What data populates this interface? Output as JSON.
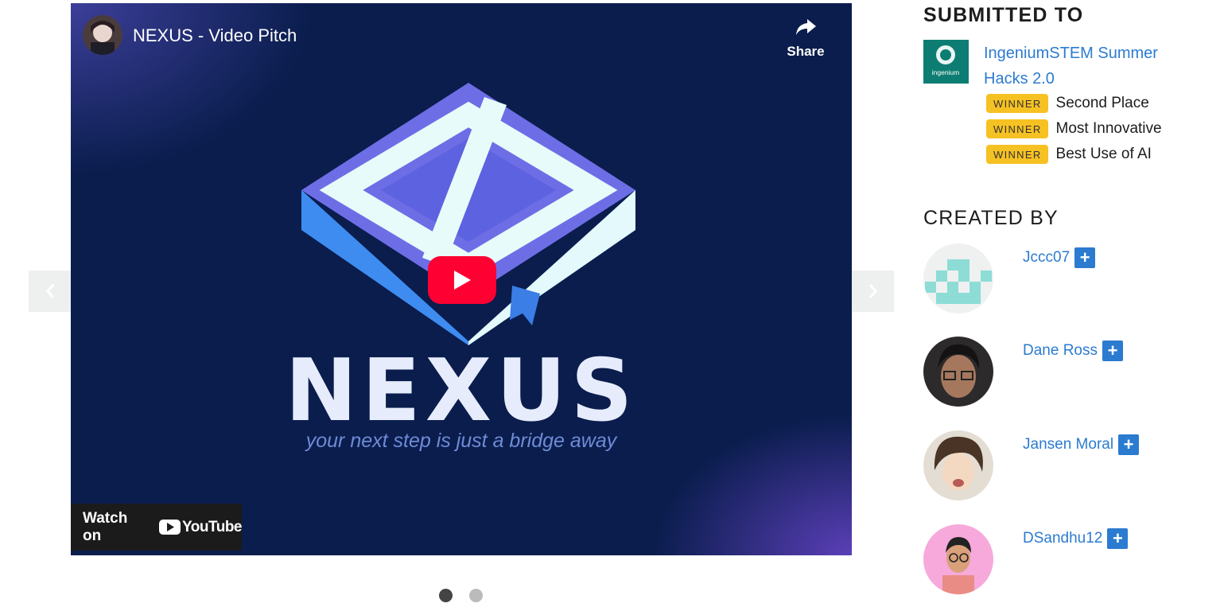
{
  "video": {
    "title": "NEXUS - Video Pitch",
    "share_label": "Share",
    "logo_word": "NEXUS",
    "tagline": "your next step is just a bridge away",
    "watch_on": "Watch on",
    "youtube_label": "YouTube"
  },
  "carousel": {
    "slide_count": 2,
    "active_index": 0
  },
  "submitted": {
    "heading": "SUBMITTED TO",
    "hackathon": "IngeniumSTEM Summer Hacks 2.0",
    "thumb_text": "ingenium",
    "prizes": [
      {
        "badge": "WINNER",
        "name": "Second Place"
      },
      {
        "badge": "WINNER",
        "name": "Most Innovative"
      },
      {
        "badge": "WINNER",
        "name": "Best Use of AI"
      }
    ]
  },
  "created": {
    "heading": "CREATED BY",
    "members": [
      {
        "name": "Jccc07",
        "follow": "+"
      },
      {
        "name": "Dane Ross",
        "follow": "+"
      },
      {
        "name": "Jansen Moral",
        "follow": "+"
      },
      {
        "name": "DSandhu12",
        "follow": "+"
      }
    ]
  },
  "colors": {
    "link": "#2b7bd0",
    "winner_badge": "#f6c122",
    "video_bg": "#0a1d4d",
    "play": "#ff0033"
  }
}
